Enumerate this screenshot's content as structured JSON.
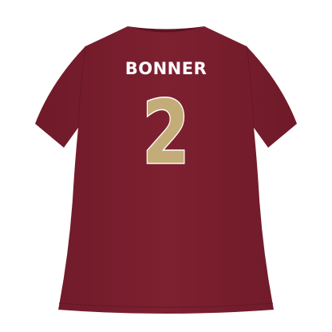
{
  "product": {
    "player_name": "BONNER",
    "jersey_number": "2"
  },
  "colors": {
    "shirt": "#7a1e2e",
    "shirt_shadow": "#671626",
    "number_fill": "#c4ac79",
    "number_outline": "#ffffff",
    "name_text": "#ffffff",
    "background": "#ffffff"
  }
}
